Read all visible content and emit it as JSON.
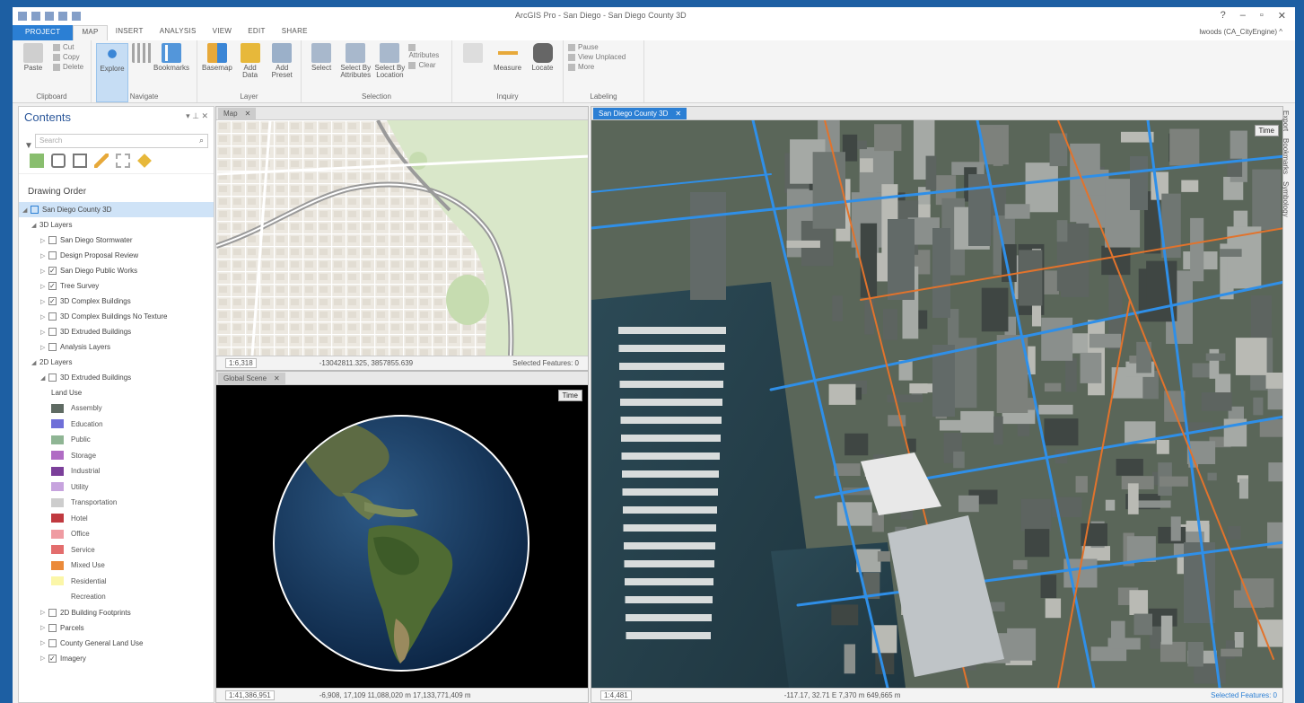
{
  "app": {
    "title": "ArcGIS Pro - San Diego - San Diego County 3D",
    "signin": "lwoods (CA_CityEngine) ^"
  },
  "ribbon": {
    "tabs": [
      "PROJECT",
      "MAP",
      "INSERT",
      "ANALYSIS",
      "VIEW",
      "EDIT",
      "SHARE"
    ],
    "active_tab": "MAP",
    "groups": [
      {
        "name": "Clipboard",
        "big": "Paste",
        "small": [
          "Cut",
          "Copy",
          "Delete"
        ]
      },
      {
        "name": "Navigate",
        "big": "Explore",
        "big2": "Bookmarks"
      },
      {
        "name": "Layer",
        "buttons": [
          "Basemap",
          "Add Data",
          "Add Preset"
        ]
      },
      {
        "name": "Selection",
        "buttons": [
          "Select",
          "Select By Attributes",
          "Select By Location"
        ],
        "small": [
          "Attributes",
          "Clear"
        ]
      },
      {
        "name": "Inquiry",
        "buttons": [
          "Measure",
          "Locate"
        ]
      },
      {
        "name": "Labeling",
        "small": [
          "Pause",
          "View Unplaced",
          "More"
        ]
      }
    ]
  },
  "contents": {
    "title": "Contents",
    "search_placeholder": "Search",
    "section": "Drawing Order",
    "map": "San Diego County 3D",
    "group_3d": "3D Layers",
    "layers_3d": [
      {
        "name": "San Diego Stormwater",
        "checked": false
      },
      {
        "name": "Design Proposal Review",
        "checked": false
      },
      {
        "name": "San Diego Public Works",
        "checked": true
      },
      {
        "name": "Tree Survey",
        "checked": true
      },
      {
        "name": "3D Complex Buildings",
        "checked": true
      },
      {
        "name": "3D Complex Buildings No Texture",
        "checked": false
      },
      {
        "name": "3D Extruded Buildings",
        "checked": false
      },
      {
        "name": "Analysis Layers",
        "checked": false
      }
    ],
    "group_2d": "2D Layers",
    "extruded": "3D Extruded Buildings",
    "land_use_title": "Land Use",
    "land_use": [
      {
        "label": "Assembly",
        "color": "#5f6b63"
      },
      {
        "label": "Education",
        "color": "#6f6fd8"
      },
      {
        "label": "Public",
        "color": "#8fb594"
      },
      {
        "label": "Storage",
        "color": "#b06cc4"
      },
      {
        "label": "Industrial",
        "color": "#7b3f9a"
      },
      {
        "label": "Utility",
        "color": "#c7a3de"
      },
      {
        "label": "Transportation",
        "color": "#cdcdcd"
      },
      {
        "label": "Hotel",
        "color": "#c0393f"
      },
      {
        "label": "Office",
        "color": "#ef9ba2"
      },
      {
        "label": "Service",
        "color": "#e36d6d"
      },
      {
        "label": "Mixed Use",
        "color": "#eb8a3a"
      },
      {
        "label": "Residential",
        "color": "#fbf6a8"
      },
      {
        "label": "Recreation",
        "color": "#ffffff"
      }
    ],
    "layers_bottom": [
      {
        "name": "2D Building Footprints",
        "checked": false
      },
      {
        "name": "Parcels",
        "checked": false
      },
      {
        "name": "County General Land Use",
        "checked": false
      },
      {
        "name": "Imagery",
        "checked": true
      }
    ]
  },
  "map2d": {
    "tab": "Map",
    "scale": "1:6,318",
    "coords": "-13042811.325, 3857855.639",
    "selected": "Selected Features: 0"
  },
  "globe": {
    "tab": "Global Scene",
    "time_btn": "Time",
    "scale": "1:41,386,951",
    "coords": "-6,908, 17,109   11,088,020 m   17,133,771,409 m"
  },
  "scene": {
    "tab": "San Diego County 3D",
    "time_btn": "Time",
    "scale": "1:4,481",
    "coords": "-117.17, 32.71 E   7,370 m   649,665 m",
    "selected": "Selected Features: 0"
  },
  "side_tabs": [
    "Export",
    "Bookmarks",
    "Symbology"
  ]
}
